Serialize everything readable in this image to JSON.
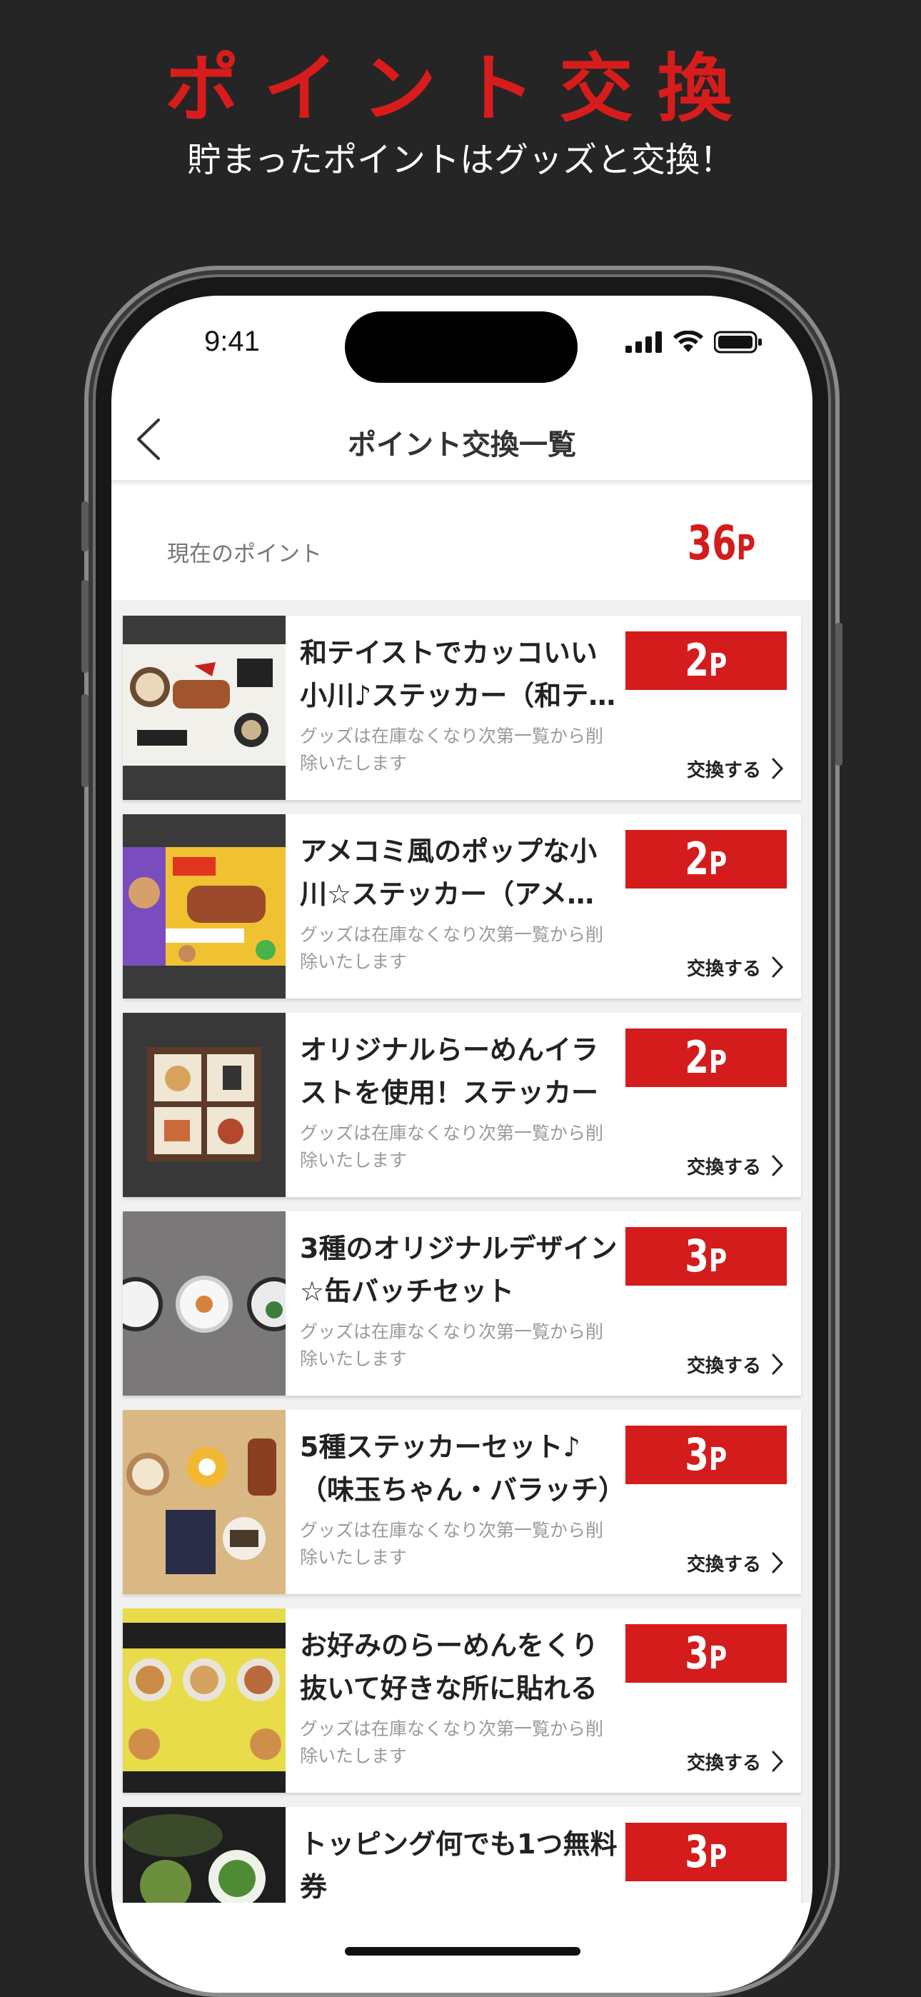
{
  "promo": {
    "title": "ポイント交換",
    "subtitle": "貯まったポイントはグッズと交換！"
  },
  "status_bar": {
    "time": "9:41",
    "icons": [
      "signal-icon",
      "wifi-icon",
      "battery-icon"
    ]
  },
  "nav": {
    "title": "ポイント交換一覧",
    "back_icon": "chevron-left-icon"
  },
  "points": {
    "label": "現在のポイント",
    "value": "36",
    "unit": "P"
  },
  "colors": {
    "accent": "#d41c1c",
    "background": "#252525"
  },
  "items": [
    {
      "title": "和テイストでカッコいい小川♪ステッカー（和テイスト）",
      "cost": "2",
      "unit": "P",
      "note": "グッズは在庫なくなり次第一覧から削除いたします",
      "action": "交換する",
      "thumb": "sticker-wa-image"
    },
    {
      "title": "アメコミ風のポップな小川☆ステッカー（アメコミ風）",
      "cost": "2",
      "unit": "P",
      "note": "グッズは在庫なくなり次第一覧から削除いたします",
      "action": "交換する",
      "thumb": "sticker-comic-image"
    },
    {
      "title": "オリジナルらーめんイラストを使用！ステッカー",
      "cost": "2",
      "unit": "P",
      "note": "グッズは在庫なくなり次第一覧から削除いたします",
      "action": "交換する",
      "thumb": "sticker-ramen-image"
    },
    {
      "title": "3種のオリジナルデザイン☆缶バッチセット",
      "cost": "3",
      "unit": "P",
      "note": "グッズは在庫なくなり次第一覧から削除いたします",
      "action": "交換する",
      "thumb": "badge-set-image"
    },
    {
      "title": "5種ステッカーセット♪（味玉ちゃん・バラッチ）",
      "cost": "3",
      "unit": "P",
      "note": "グッズは在庫なくなり次第一覧から削除いたします",
      "action": "交換する",
      "thumb": "sticker-set-image"
    },
    {
      "title": "お好みのらーめんをくり抜いて好きな所に貼れる",
      "cost": "3",
      "unit": "P",
      "note": "グッズは在庫なくなり次第一覧から削除いたします",
      "action": "交換する",
      "thumb": "ramen-cutout-image"
    },
    {
      "title": "トッピング何でも1つ無料券",
      "cost": "3",
      "unit": "P",
      "note": "",
      "action": "",
      "thumb": "topping-ticket-image"
    }
  ]
}
